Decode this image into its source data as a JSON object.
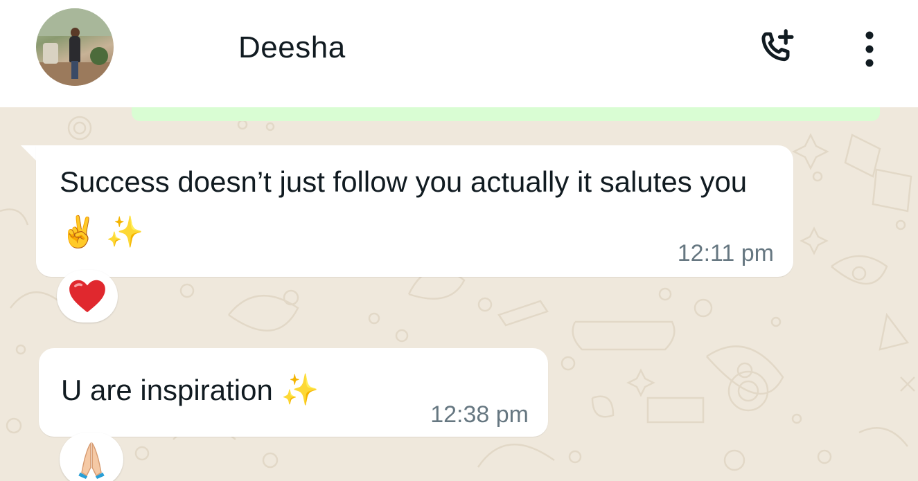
{
  "header": {
    "contact_name": "Deesha"
  },
  "messages": [
    {
      "text": "Success doesn’t just follow you actually it salutes you",
      "emoji": [
        "✌️",
        "✨"
      ],
      "time": "12:11 pm",
      "reaction": "❤️",
      "reaction_icon": "red-heart-icon"
    },
    {
      "text": "U are inspiration",
      "emoji": [
        "✨"
      ],
      "time": "12:38 pm",
      "reaction": "🙏",
      "reaction_icon": "folded-hands-icon"
    }
  ],
  "icons": {
    "call": "add-call-icon",
    "menu": "more-options-icon"
  },
  "colors": {
    "header_bg": "#ffffff",
    "chat_bg": "#efe8dc",
    "incoming_bubble": "#ffffff",
    "outgoing_bubble": "#d9fdd3",
    "timestamp": "#667781",
    "text": "#111b21"
  }
}
